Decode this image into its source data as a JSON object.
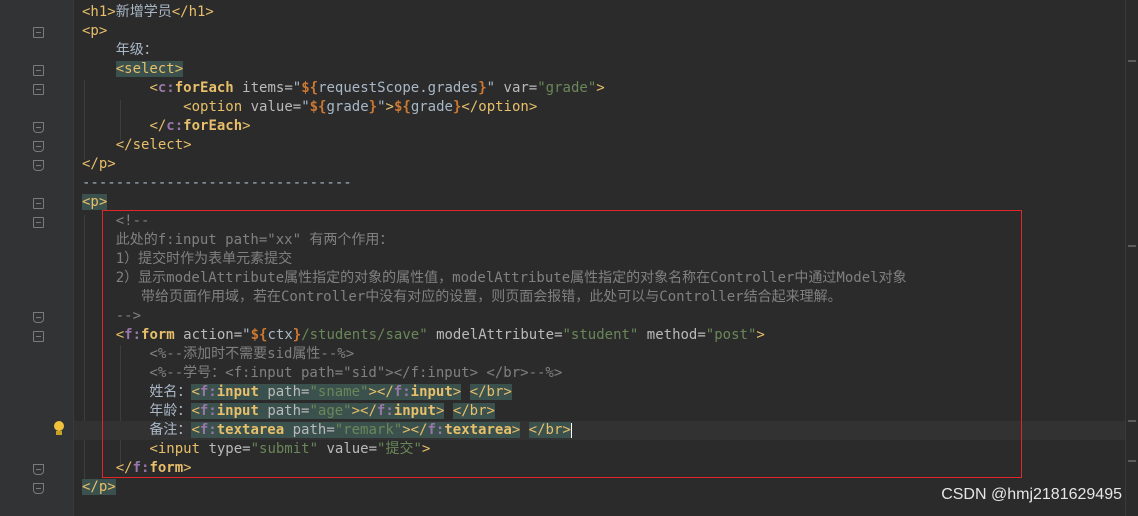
{
  "lines": [
    [
      {
        "t": "<h1>",
        "c": "tag"
      },
      {
        "t": "新增学员"
      },
      {
        "t": "</h1>",
        "c": "tag"
      }
    ],
    [
      {
        "t": "<p>",
        "c": "tag"
      }
    ],
    [
      {
        "t": "    年级："
      }
    ],
    [
      {
        "t": "    "
      },
      {
        "t": "<select>",
        "c": "tag hl"
      }
    ],
    [
      {
        "t": "        "
      },
      {
        "t": "<",
        "c": "tag"
      },
      {
        "t": "c:",
        "c": "pfx"
      },
      {
        "t": "forEach",
        "c": "tname"
      },
      {
        "t": " items=",
        "c": "attr"
      },
      {
        "t": "\""
      },
      {
        "t": "${",
        "c": "el"
      },
      {
        "t": "requestScope.grades"
      },
      {
        "t": "}",
        "c": "el"
      },
      {
        "t": "\""
      },
      {
        "t": " var=",
        "c": "attr"
      },
      {
        "t": "\"grade\"",
        "c": "str"
      },
      {
        "t": ">",
        "c": "tag"
      }
    ],
    [
      {
        "t": "            "
      },
      {
        "t": "<option",
        "c": "tag"
      },
      {
        "t": " value=",
        "c": "attr"
      },
      {
        "t": "\""
      },
      {
        "t": "${",
        "c": "el"
      },
      {
        "t": "grade"
      },
      {
        "t": "}",
        "c": "el"
      },
      {
        "t": "\""
      },
      {
        "t": ">",
        "c": "tag"
      },
      {
        "t": "${",
        "c": "el"
      },
      {
        "t": "grade"
      },
      {
        "t": "}",
        "c": "el"
      },
      {
        "t": "</option>",
        "c": "tag"
      }
    ],
    [
      {
        "t": "        "
      },
      {
        "t": "</",
        "c": "tag"
      },
      {
        "t": "c:",
        "c": "pfx"
      },
      {
        "t": "forEach",
        "c": "tname"
      },
      {
        "t": ">",
        "c": "tag"
      }
    ],
    [
      {
        "t": "    "
      },
      {
        "t": "</select>",
        "c": "tag"
      }
    ],
    [
      {
        "t": "</p>",
        "c": "tag"
      }
    ],
    [
      {
        "t": "--------------------------------"
      }
    ],
    [
      {
        "t": "<p>",
        "c": "tag hl"
      }
    ],
    [
      {
        "t": "    <!--",
        "c": "cmt"
      }
    ],
    [
      {
        "t": "    此处的f:input path=\"xx\" 有两个作用：",
        "c": "cmt"
      }
    ],
    [
      {
        "t": "    1）提交时作为表单元素提交",
        "c": "cmt"
      }
    ],
    [
      {
        "t": "    2）显示modelAttribute属性指定的对象的属性值，modelAttribute属性指定的对象名称在Controller中通过Model对象",
        "c": "cmt"
      }
    ],
    [
      {
        "t": "       带给页面作用域，若在Controller中没有对应的设置，则页面会报错，此处可以与Controller结合起来理解。",
        "c": "cmt"
      }
    ],
    [
      {
        "t": "    -->",
        "c": "cmt"
      }
    ],
    [
      {
        "t": "    "
      },
      {
        "t": "<",
        "c": "tag"
      },
      {
        "t": "f:",
        "c": "pfx"
      },
      {
        "t": "form",
        "c": "tname"
      },
      {
        "t": " action=",
        "c": "attr"
      },
      {
        "t": "\""
      },
      {
        "t": "${",
        "c": "el"
      },
      {
        "t": "ctx"
      },
      {
        "t": "}",
        "c": "el"
      },
      {
        "t": "/students/save\"",
        "c": "str"
      },
      {
        "t": " modelAttribute=",
        "c": "attr"
      },
      {
        "t": "\"student\"",
        "c": "str"
      },
      {
        "t": " method=",
        "c": "attr"
      },
      {
        "t": "\"post\"",
        "c": "str"
      },
      {
        "t": ">",
        "c": "tag"
      }
    ],
    [
      {
        "t": "        <%--添加时不需要sid属性--%>",
        "c": "cmt"
      }
    ],
    [
      {
        "t": "        <%--学号：<f:input path=\"sid\"></f:input> </br>--%>",
        "c": "cmt"
      }
    ],
    [
      {
        "t": "        姓名："
      },
      {
        "t": "<",
        "c": "tag hl"
      },
      {
        "t": "f:",
        "c": "pfx hl"
      },
      {
        "t": "input",
        "c": "tname hl"
      },
      {
        "t": " path=",
        "c": "attr hl"
      },
      {
        "t": "\"sname\"",
        "c": "str hl"
      },
      {
        "t": "></",
        "c": "tag hl"
      },
      {
        "t": "f:",
        "c": "pfx hl"
      },
      {
        "t": "input",
        "c": "tname hl"
      },
      {
        "t": ">",
        "c": "tag hl"
      },
      {
        "t": " "
      },
      {
        "t": "</br>",
        "c": "tag hl"
      }
    ],
    [
      {
        "t": "        年龄："
      },
      {
        "t": "<",
        "c": "tag hl"
      },
      {
        "t": "f:",
        "c": "pfx hl"
      },
      {
        "t": "input",
        "c": "tname hl"
      },
      {
        "t": " path=",
        "c": "attr hl"
      },
      {
        "t": "\"age\"",
        "c": "str hl"
      },
      {
        "t": "></",
        "c": "tag hl"
      },
      {
        "t": "f:",
        "c": "pfx hl"
      },
      {
        "t": "input",
        "c": "tname hl"
      },
      {
        "t": ">",
        "c": "tag hl"
      },
      {
        "t": " "
      },
      {
        "t": "</br>",
        "c": "tag hl"
      }
    ],
    [
      {
        "t": "        备注："
      },
      {
        "t": "<",
        "c": "tag hl"
      },
      {
        "t": "f:",
        "c": "pfx hl"
      },
      {
        "t": "textarea",
        "c": "tname hl"
      },
      {
        "t": " path=",
        "c": "attr hl"
      },
      {
        "t": "\"remark\"",
        "c": "str hl"
      },
      {
        "t": "></",
        "c": "tag hl"
      },
      {
        "t": "f:",
        "c": "pfx hl"
      },
      {
        "t": "textarea",
        "c": "tname hl"
      },
      {
        "t": ">",
        "c": "tag hl"
      },
      {
        "t": " "
      },
      {
        "t": "</br>",
        "c": "tag hl"
      }
    ],
    [
      {
        "t": "        "
      },
      {
        "t": "<input",
        "c": "tag"
      },
      {
        "t": " type=",
        "c": "attr"
      },
      {
        "t": "\"submit\"",
        "c": "str"
      },
      {
        "t": " value=",
        "c": "attr"
      },
      {
        "t": "\"提交\"",
        "c": "str"
      },
      {
        "t": ">",
        "c": "tag"
      }
    ],
    [
      {
        "t": "    "
      },
      {
        "t": "</",
        "c": "tag"
      },
      {
        "t": "f:",
        "c": "pfx"
      },
      {
        "t": "form",
        "c": "tname"
      },
      {
        "t": ">",
        "c": "tag"
      }
    ],
    [
      {
        "t": "</p>",
        "c": "tag hl"
      }
    ]
  ],
  "current_line": 22,
  "watermark": "CSDN @hmj2181629495",
  "icons": {
    "fold_marker": "fold-marker-icon",
    "intention_bulb": "lightbulb-icon"
  },
  "colors": {
    "background": "#2b2b2b",
    "gutter": "#313335",
    "tag": "#e8bf6a",
    "string": "#6a8759",
    "comment": "#808080",
    "highlight_box": "#e0262a"
  }
}
